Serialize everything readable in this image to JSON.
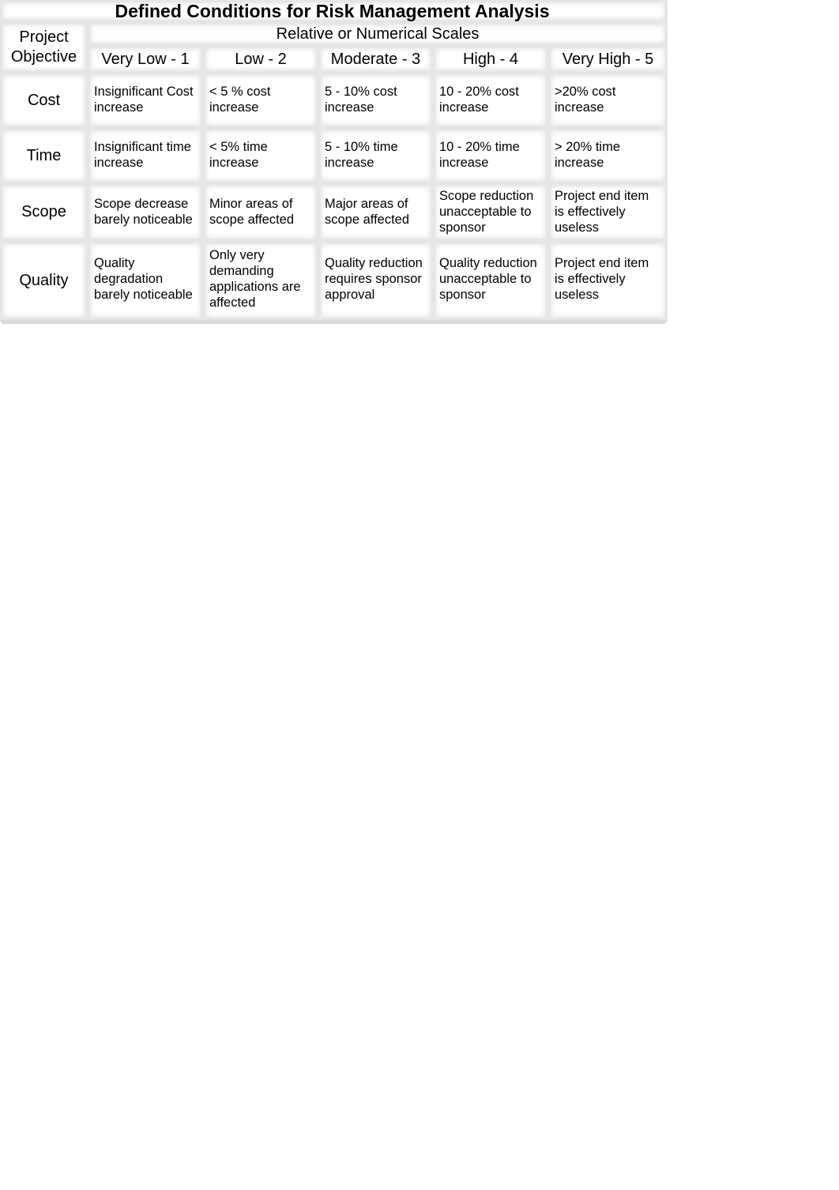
{
  "title": "Defined Conditions for Risk Management Analysis",
  "objective_header": [
    "Project",
    "Objective"
  ],
  "scales_header": "Relative or Numerical Scales",
  "levels": [
    "Very Low - 1",
    "Low - 2",
    "Moderate - 3",
    "High - 4",
    "Very High - 5"
  ],
  "rows": [
    {
      "objective": "Cost",
      "cells": [
        [
          "Insignificant Cost",
          "increase"
        ],
        [
          "< 5 % cost",
          "increase"
        ],
        [
          "5 - 10% cost",
          "increase"
        ],
        [
          "10 - 20% cost",
          "increase"
        ],
        [
          ">20% cost",
          "increase"
        ]
      ]
    },
    {
      "objective": "Time",
      "cells": [
        [
          "Insignificant time",
          "increase"
        ],
        [
          "< 5% time",
          "increase"
        ],
        [
          "5 - 10% time",
          "increase"
        ],
        [
          "10 - 20% time",
          "increase"
        ],
        [
          "> 20% time",
          "increase"
        ]
      ]
    },
    {
      "objective": "Scope",
      "cells": [
        [
          "Scope decrease",
          "barely noticeable"
        ],
        [
          "Minor areas of",
          "scope affected"
        ],
        [
          "Major areas of",
          "scope affected"
        ],
        [
          "Scope reduction",
          "unacceptable to",
          "sponsor"
        ],
        [
          "Project end item",
          "is effectively",
          "useless"
        ]
      ]
    },
    {
      "objective": "Quality",
      "cells": [
        [
          "Quality",
          "degradation",
          "barely noticeable"
        ],
        [
          "Only very",
          "demanding",
          "applications are",
          "affected"
        ],
        [
          "Quality reduction",
          "requires sponsor",
          "approval"
        ],
        [
          "Quality reduction",
          "unacceptable to",
          "sponsor"
        ],
        [
          "Project end item",
          "is effectively",
          "useless"
        ]
      ]
    }
  ]
}
